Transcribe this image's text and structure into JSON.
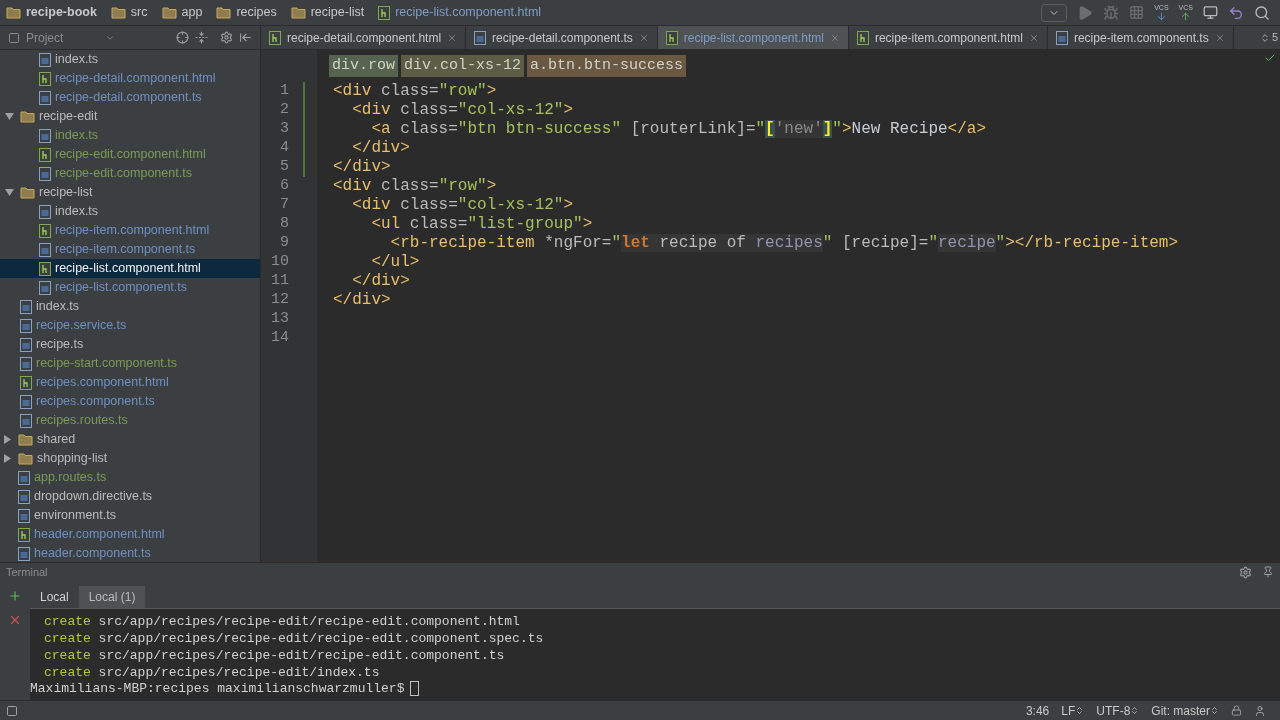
{
  "breadcrumbs": [
    {
      "kind": "project",
      "text": "recipe-book"
    },
    {
      "kind": "folder",
      "text": "src"
    },
    {
      "kind": "folder",
      "text": "app"
    },
    {
      "kind": "folder",
      "text": "recipes"
    },
    {
      "kind": "folder",
      "text": "recipe-list"
    },
    {
      "kind": "html",
      "text": "recipe-list.component.html"
    }
  ],
  "toolbar": [
    {
      "kind": "dropdown",
      "disabled": false
    },
    {
      "kind": "run",
      "disabled": true
    },
    {
      "kind": "debug",
      "disabled": true
    },
    {
      "kind": "coverage",
      "disabled": true
    },
    {
      "kind": "vcs-update",
      "label": "VCS",
      "disabled": false
    },
    {
      "kind": "vcs-commit",
      "label": "VCS",
      "disabled": false
    },
    {
      "kind": "history",
      "disabled": false
    },
    {
      "kind": "revert",
      "disabled": false
    },
    {
      "kind": "search",
      "disabled": false
    }
  ],
  "project_panel": {
    "title": "Project"
  },
  "tree": [
    {
      "children": [
        {
          "children": [
            {
              "name": "index.ts",
              "kind": "ts",
              "color": "#bbbbbb",
              "selected": false
            },
            {
              "name": "recipe-detail.component.html",
              "kind": "html",
              "color": "#6f8fc4",
              "selected": false
            },
            {
              "name": "recipe-detail.component.ts",
              "kind": "ts",
              "color": "#6f8fc4",
              "selected": false
            }
          ]
        },
        {
          "name": "recipe-edit",
          "kind": "folder",
          "color": "#bbbbbb",
          "selected": false,
          "expanded": true,
          "children": [
            {
              "name": "index.ts",
              "kind": "ts",
              "color": "#7a9a56",
              "selected": false
            },
            {
              "name": "recipe-edit.component.html",
              "kind": "html",
              "color": "#7a9a56",
              "selected": false
            },
            {
              "name": "recipe-edit.component.ts",
              "kind": "ts",
              "color": "#7a9a56",
              "selected": false
            }
          ]
        },
        {
          "name": "recipe-list",
          "kind": "folder",
          "color": "#bbbbbb",
          "selected": false,
          "expanded": true,
          "children": [
            {
              "name": "index.ts",
              "kind": "ts",
              "color": "#bbbbbb",
              "selected": false
            },
            {
              "name": "recipe-item.component.html",
              "kind": "html",
              "color": "#6f8fc4",
              "selected": false
            },
            {
              "name": "recipe-item.component.ts",
              "kind": "ts",
              "color": "#6f8fc4",
              "selected": false
            },
            {
              "name": "recipe-list.component.html",
              "kind": "html",
              "selected": true
            },
            {
              "name": "recipe-list.component.ts",
              "kind": "ts",
              "color": "#6f8fc4",
              "selected": false
            }
          ]
        },
        {
          "name": "index.ts",
          "kind": "ts",
          "color": "#bbbbbb",
          "selected": false
        },
        {
          "name": "recipe.service.ts",
          "kind": "ts",
          "color": "#6f8fc4",
          "selected": false
        },
        {
          "name": "recipe.ts",
          "kind": "ts",
          "color": "#bbbbbb",
          "selected": false
        },
        {
          "name": "recipe-start.component.ts",
          "kind": "ts",
          "color": "#7a9a56",
          "selected": false
        },
        {
          "name": "recipes.component.html",
          "kind": "html",
          "color": "#6f8fc4",
          "selected": false
        },
        {
          "name": "recipes.component.ts",
          "kind": "ts",
          "color": "#6f8fc4",
          "selected": false
        },
        {
          "name": "recipes.routes.ts",
          "kind": "ts",
          "color": "#7a9a56",
          "selected": false
        }
      ]
    },
    {
      "name": "shared",
      "kind": "folder",
      "color": "#bbbbbb",
      "selected": false,
      "expanded": false
    },
    {
      "name": "shopping-list",
      "kind": "folder",
      "color": "#bbbbbb",
      "selected": false,
      "expanded": false
    },
    {
      "name": "app.routes.ts",
      "kind": "ts",
      "color": "#7a9a56",
      "selected": false
    },
    {
      "name": "dropdown.directive.ts",
      "kind": "ts",
      "color": "#bbbbbb",
      "selected": false
    },
    {
      "name": "environment.ts",
      "kind": "ts",
      "color": "#bbbbbb",
      "selected": false
    },
    {
      "name": "header.component.html",
      "kind": "html",
      "color": "#6f8fc4",
      "selected": false
    },
    {
      "name": "header.component.ts",
      "kind": "ts",
      "color": "#6f8fc4",
      "selected": false
    }
  ],
  "tabs": [
    {
      "label": "recipe-detail.component.html",
      "kind": "html",
      "selected": false
    },
    {
      "label": "recipe-detail.component.ts",
      "kind": "ts",
      "selected": false
    },
    {
      "label": "recipe-list.component.html",
      "kind": "html",
      "selected": true
    },
    {
      "label": "recipe-item.component.html",
      "kind": "html",
      "selected": false
    },
    {
      "label": "recipe-item.component.ts",
      "kind": "ts",
      "selected": false
    }
  ],
  "tab_overflow": "5",
  "tag_path": [
    {
      "text": "div.row",
      "color": "#56634f"
    },
    {
      "text": "div.col-xs-12",
      "color": "#5c5d45"
    },
    {
      "text": "a.btn.btn-success",
      "color": "#6a5843"
    }
  ],
  "code": {
    "lines": [
      {
        "number": "1",
        "changed": true,
        "tokens": [
          {
            "kind": "tag",
            "text": "<div"
          },
          {
            "kind": "attr",
            "text": " class"
          },
          {
            "kind": "punct",
            "text": "="
          },
          {
            "kind": "string",
            "text": "\"row\""
          },
          {
            "kind": "tag",
            "text": ">"
          }
        ]
      },
      {
        "number": "2",
        "changed": true,
        "tokens": [
          {
            "kind": "tag",
            "text": "  <div"
          },
          {
            "kind": "attr",
            "text": " class"
          },
          {
            "kind": "punct",
            "text": "="
          },
          {
            "kind": "string",
            "text": "\"col-xs-12\""
          },
          {
            "kind": "tag",
            "text": ">"
          }
        ]
      },
      {
        "number": "3",
        "changed": true,
        "tokens": [
          {
            "kind": "tag",
            "text": "    <a"
          },
          {
            "kind": "attr",
            "text": " class"
          },
          {
            "kind": "punct",
            "text": "="
          },
          {
            "kind": "string",
            "text": "\"btn btn-success\""
          },
          {
            "kind": "attr",
            "text": " [routerLink]"
          },
          {
            "kind": "punct",
            "text": "="
          },
          {
            "kind": "string",
            "text": "\""
          },
          {
            "kind": "bracket",
            "text": "["
          },
          {
            "kind": "inj-string",
            "text": "'new'"
          },
          {
            "kind": "bracket",
            "text": "]"
          },
          {
            "kind": "string",
            "text": "\""
          },
          {
            "kind": "tag",
            "text": ">"
          },
          {
            "kind": "text",
            "text": "New Recipe"
          },
          {
            "kind": "tag",
            "text": "</a>"
          }
        ]
      },
      {
        "number": "4",
        "changed": true,
        "tokens": [
          {
            "kind": "tag",
            "text": "  </div>"
          }
        ]
      },
      {
        "number": "5",
        "changed": true,
        "tokens": [
          {
            "kind": "tag",
            "text": "</div>"
          }
        ]
      },
      {
        "number": "6",
        "changed": false,
        "tokens": [
          {
            "kind": "tag",
            "text": "<div"
          },
          {
            "kind": "attr",
            "text": " class"
          },
          {
            "kind": "punct",
            "text": "="
          },
          {
            "kind": "string",
            "text": "\"row\""
          },
          {
            "kind": "tag",
            "text": ">"
          }
        ]
      },
      {
        "number": "7",
        "changed": false,
        "tokens": [
          {
            "kind": "tag",
            "text": "  <div"
          },
          {
            "kind": "attr",
            "text": " class"
          },
          {
            "kind": "punct",
            "text": "="
          },
          {
            "kind": "string",
            "text": "\"col-xs-12\""
          },
          {
            "kind": "tag",
            "text": ">"
          }
        ]
      },
      {
        "number": "8",
        "changed": false,
        "tokens": [
          {
            "kind": "tag",
            "text": "    <ul"
          },
          {
            "kind": "attr",
            "text": " class"
          },
          {
            "kind": "punct",
            "text": "="
          },
          {
            "kind": "string",
            "text": "\"list-group\""
          },
          {
            "kind": "tag",
            "text": ">"
          }
        ]
      },
      {
        "number": "9",
        "changed": false,
        "tokens": [
          {
            "kind": "tag",
            "text": "      <rb-recipe-item"
          },
          {
            "kind": "attr",
            "text": " *ngFor"
          },
          {
            "kind": "punct",
            "text": "="
          },
          {
            "kind": "string",
            "text": "\""
          },
          {
            "kind": "inj-keyword",
            "text": "let"
          },
          {
            "kind": "inj-text",
            "text": " recipe of "
          },
          {
            "kind": "inj-ident",
            "text": "recipes"
          },
          {
            "kind": "string",
            "text": "\""
          },
          {
            "kind": "attr",
            "text": " [recipe]"
          },
          {
            "kind": "punct",
            "text": "="
          },
          {
            "kind": "string",
            "text": "\""
          },
          {
            "kind": "inj-ident",
            "text": "recipe"
          },
          {
            "kind": "string",
            "text": "\""
          },
          {
            "kind": "tag",
            "text": "></rb-recipe-item>"
          }
        ]
      },
      {
        "number": "10",
        "changed": false,
        "tokens": [
          {
            "kind": "tag",
            "text": "    </ul>"
          }
        ]
      },
      {
        "number": "11",
        "changed": false,
        "tokens": [
          {
            "kind": "tag",
            "text": "  </div>"
          }
        ]
      },
      {
        "number": "12",
        "changed": false,
        "tokens": [
          {
            "kind": "tag",
            "text": "</div>"
          }
        ]
      },
      {
        "number": "13",
        "changed": false
      },
      {
        "number": "14",
        "changed": false
      }
    ]
  },
  "terminal": {
    "title": "Terminal",
    "tabs": [
      {
        "label": "Local",
        "selected": false
      },
      {
        "label": "Local (1)",
        "selected": true
      }
    ],
    "lines": [
      {
        "kind": "output",
        "verb": "create",
        "text": " src/app/recipes/recipe-edit/recipe-edit.component.html"
      },
      {
        "kind": "output",
        "verb": "create",
        "text": " src/app/recipes/recipe-edit/recipe-edit.component.spec.ts"
      },
      {
        "kind": "output",
        "verb": "create",
        "text": " src/app/recipes/recipe-edit/recipe-edit.component.ts"
      },
      {
        "kind": "output",
        "verb": "create",
        "text": " src/app/recipes/recipe-edit/index.ts"
      },
      {
        "kind": "prompt",
        "text": "Maximilians-MBP:recipes maximilianschwarzmuller$"
      }
    ]
  },
  "status_bar": [
    {
      "text": "3:46",
      "dropdown": false
    },
    {
      "text": "LF",
      "dropdown": true
    },
    {
      "text": "UTF-8",
      "dropdown": true
    },
    {
      "text": "Git: master",
      "dropdown": true
    }
  ]
}
